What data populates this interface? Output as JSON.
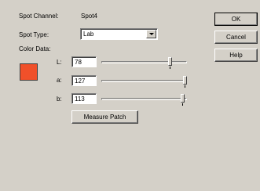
{
  "spot_channel": {
    "label": "Spot Channel:",
    "value": "Spot4"
  },
  "spot_type": {
    "label": "Spot Type:",
    "value": "Lab"
  },
  "color_data": {
    "label": "Color Data:",
    "swatch_color": "#f0502a"
  },
  "lab": {
    "L": {
      "label": "L:",
      "value": "78"
    },
    "a": {
      "label": "a:",
      "value": "127"
    },
    "b": {
      "label": "b:",
      "value": "113"
    }
  },
  "slider_levels": {
    "L": 0.82,
    "a": 1.0,
    "b": 0.97
  },
  "buttons": {
    "ok": "OK",
    "cancel": "Cancel",
    "help": "Help",
    "measure_patch": "Measure Patch"
  }
}
